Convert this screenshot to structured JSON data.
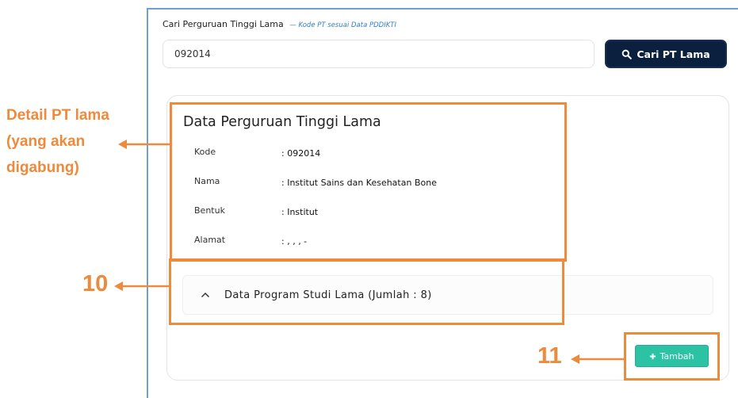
{
  "search": {
    "label": "Cari Perguruan Tinggi Lama",
    "hint": "— Kode PT sesuai Data PDDIKTI",
    "value": "092014",
    "button_label": "Cari PT Lama",
    "button_icon": "search-icon"
  },
  "detail": {
    "title": "Data Perguruan Tinggi Lama",
    "rows": [
      {
        "key": "Kode",
        "value": ": 092014"
      },
      {
        "key": "Nama",
        "value": ": Institut Sains dan Kesehatan Bone"
      },
      {
        "key": "Bentuk",
        "value": ": Institut"
      },
      {
        "key": "Alamat",
        "value": ": , , , -"
      }
    ]
  },
  "accordion": {
    "label": "Data Program Studi Lama (Jumlah : 8)",
    "icon": "chevron-up-icon"
  },
  "add_button": {
    "label": "Tambah",
    "icon": "plus-icon"
  },
  "annotations": {
    "detail_lines": [
      "Detail PT lama",
      "(yang akan",
      "digabung)"
    ],
    "label_10": "10",
    "label_11": "11",
    "color": "#ee8a3c"
  },
  "colors": {
    "primary_dark": "#0b1f3f",
    "success": "#2cc3a5",
    "hint_blue": "#2f7fd1"
  }
}
